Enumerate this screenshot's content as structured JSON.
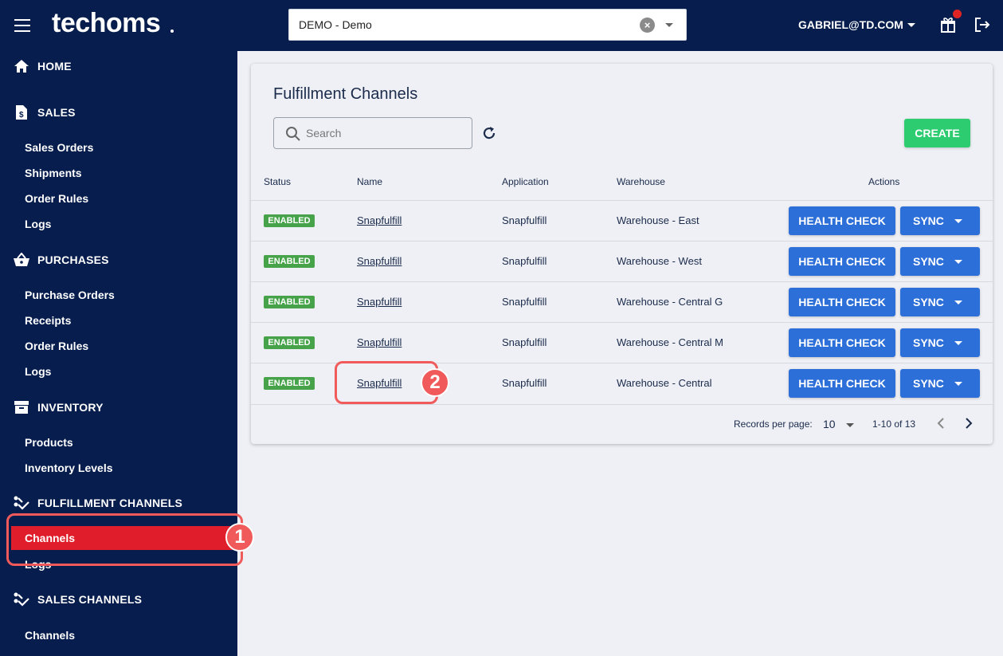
{
  "header": {
    "logo": "techoms",
    "org_select": {
      "value": "DEMO - Demo"
    },
    "user": "GABRIEL@TD.COM"
  },
  "sidebar": {
    "sections": [
      {
        "label": "HOME",
        "icon": "home-icon"
      },
      {
        "label": "SALES",
        "icon": "sales-doc-icon",
        "items": [
          "Sales Orders",
          "Shipments",
          "Order Rules",
          "Logs"
        ]
      },
      {
        "label": "PURCHASES",
        "icon": "basket-icon",
        "items": [
          "Purchase Orders",
          "Receipts",
          "Order Rules",
          "Logs"
        ]
      },
      {
        "label": "INVENTORY",
        "icon": "archive-icon",
        "items": [
          "Products",
          "Inventory Levels"
        ]
      },
      {
        "label": "FULFILLMENT CHANNELS",
        "icon": "channels-icon",
        "items": [
          "Channels",
          "Logs"
        ]
      },
      {
        "label": "SALES CHANNELS",
        "icon": "channels-icon",
        "items": [
          "Channels"
        ]
      }
    ],
    "active_item": "Channels"
  },
  "annotations": {
    "step1": "1",
    "step2": "2",
    "color": "#f05a5a"
  },
  "main": {
    "title": "Fulfillment Channels",
    "search_placeholder": "Search",
    "create_label": "CREATE",
    "columns": [
      "Status",
      "Name",
      "Application",
      "Warehouse",
      "Actions"
    ],
    "rows": [
      {
        "status": "ENABLED",
        "name": "Snapfulfill",
        "application": "Snapfulfill",
        "warehouse": "Warehouse - East"
      },
      {
        "status": "ENABLED",
        "name": "Snapfulfill",
        "application": "Snapfulfill",
        "warehouse": "Warehouse - West"
      },
      {
        "status": "ENABLED",
        "name": "Snapfulfill",
        "application": "Snapfulfill",
        "warehouse": "Warehouse - Central G"
      },
      {
        "status": "ENABLED",
        "name": "Snapfulfill",
        "application": "Snapfulfill",
        "warehouse": "Warehouse - Central M"
      },
      {
        "status": "ENABLED",
        "name": "Snapfulfill",
        "application": "Snapfulfill",
        "warehouse": "Warehouse - Central"
      }
    ],
    "actions": {
      "health_check": "HEALTH CHECK",
      "sync": "SYNC"
    },
    "pagination": {
      "records_label": "Records per page:",
      "per_page": "10",
      "range": "1-10 of 13"
    }
  },
  "colors": {
    "nav_bg": "#061d4d",
    "active_item": "#e01e2b",
    "create": "#2ecc71",
    "action_btn": "#2d6fd8",
    "badge": "#46a34a"
  }
}
